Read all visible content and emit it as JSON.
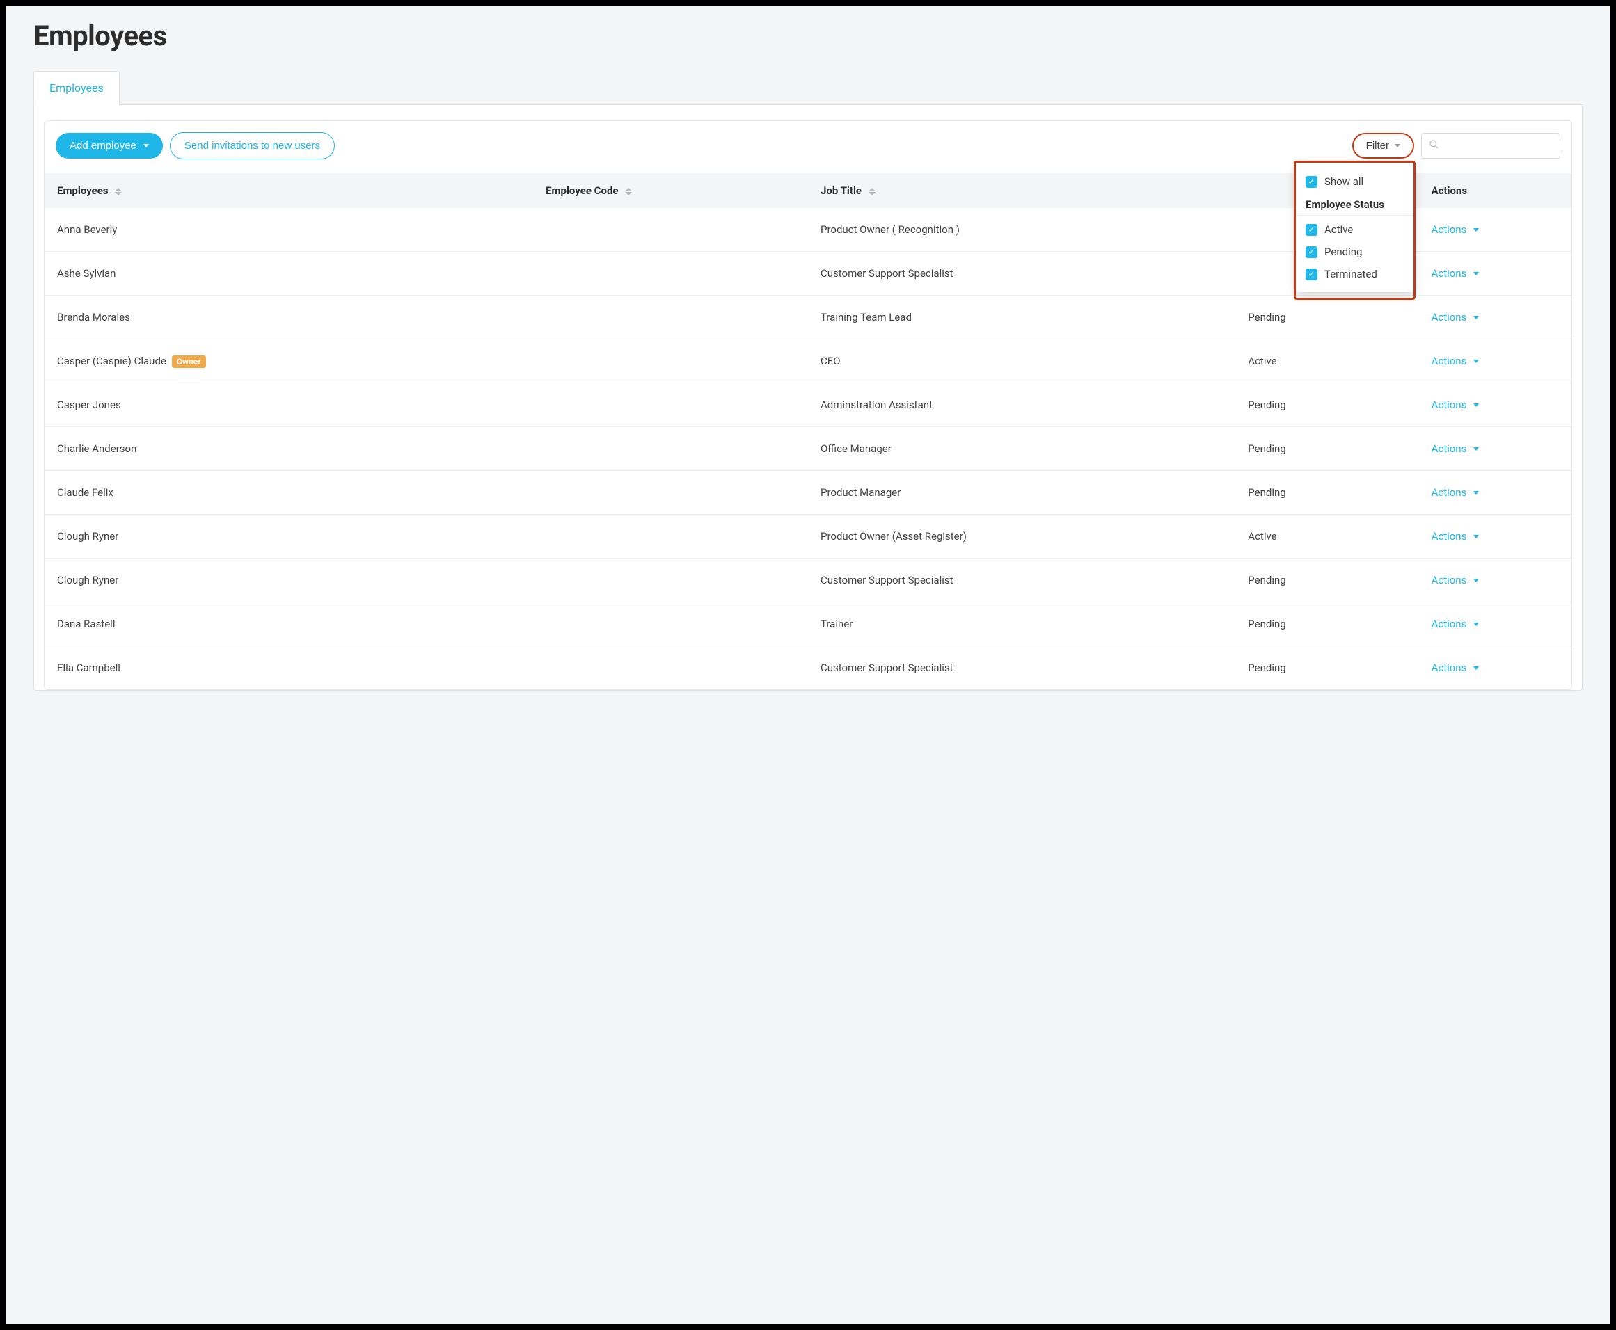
{
  "page_title": "Employees",
  "tabs": [
    {
      "label": "Employees",
      "active": true
    }
  ],
  "toolbar": {
    "add_employee_label": "Add employee",
    "send_invites_label": "Send invitations to new users",
    "filter_label": "Filter",
    "search_placeholder": ""
  },
  "filter_popover": {
    "show_all_label": "Show all",
    "group_title": "Employee Status",
    "options": [
      {
        "label": "Active",
        "checked": true
      },
      {
        "label": "Pending",
        "checked": true
      },
      {
        "label": "Terminated",
        "checked": true
      }
    ]
  },
  "table": {
    "headers": {
      "employees": "Employees",
      "employee_code": "Employee Code",
      "job_title": "Job Title",
      "status": "",
      "actions": "Actions"
    },
    "actions_label": "Actions",
    "owner_badge": "Owner",
    "rows": [
      {
        "name": "Anna Beverly",
        "code": "",
        "job_title": "Product Owner ( Recognition )",
        "status": "",
        "owner": false
      },
      {
        "name": "Ashe Sylvian",
        "code": "",
        "job_title": "Customer Support Specialist",
        "status": "",
        "owner": false
      },
      {
        "name": "Brenda Morales",
        "code": "",
        "job_title": "Training Team Lead",
        "status": "Pending",
        "owner": false
      },
      {
        "name": "Casper (Caspie) Claude",
        "code": "",
        "job_title": "CEO",
        "status": "Active",
        "owner": true
      },
      {
        "name": "Casper Jones",
        "code": "",
        "job_title": "Adminstration Assistant",
        "status": "Pending",
        "owner": false
      },
      {
        "name": "Charlie Anderson",
        "code": "",
        "job_title": "Office Manager",
        "status": "Pending",
        "owner": false
      },
      {
        "name": "Claude Felix",
        "code": "",
        "job_title": "Product Manager",
        "status": "Pending",
        "owner": false
      },
      {
        "name": "Clough Ryner",
        "code": "",
        "job_title": "Product Owner (Asset Register)",
        "status": "Active",
        "owner": false
      },
      {
        "name": "Clough Ryner",
        "code": "",
        "job_title": "Customer Support Specialist",
        "status": "Pending",
        "owner": false
      },
      {
        "name": "Dana Rastell",
        "code": "",
        "job_title": "Trainer",
        "status": "Pending",
        "owner": false
      },
      {
        "name": "Ella Campbell",
        "code": "",
        "job_title": "Customer Support Specialist",
        "status": "Pending",
        "owner": false
      }
    ]
  },
  "colors": {
    "accent": "#1fb6e8",
    "highlight": "#c23b16",
    "owner_badge": "#f0a94b"
  }
}
